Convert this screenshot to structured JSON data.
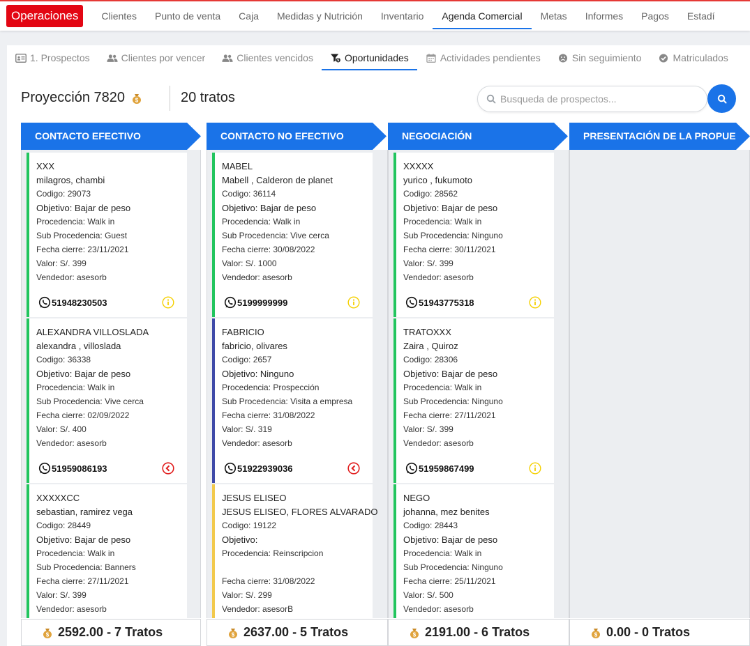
{
  "nav": {
    "brand": "Operaciones",
    "items": [
      "Clientes",
      "Punto de venta",
      "Caja",
      "Medidas y Nutrición",
      "Inventario",
      "Agenda Comercial",
      "Metas",
      "Informes",
      "Pagos",
      "Estadí"
    ],
    "active_index": 5
  },
  "subtabs": {
    "items": [
      "1. Prospectos",
      "Clientes por vencer",
      "Clientes vencidos",
      "Oportunidades",
      "Actividades pendientes",
      "Sin seguimiento",
      "Matriculados"
    ],
    "icons": [
      "id-card-icon",
      "users-icon",
      "users-icon",
      "funnel-icon",
      "calendar-icon",
      "frown-icon",
      "check-circle-icon"
    ],
    "active_index": 3
  },
  "summary": {
    "projection": "Proyección 7820",
    "deals": "20 tratos"
  },
  "search": {
    "placeholder": "Busqueda de prospectos..."
  },
  "colors": {
    "accent": "#1a73e8",
    "brand": "#e30613",
    "green": "#22c55e",
    "navy": "#3f4aa8",
    "yellow": "#f2c94c",
    "red": "#e11d1d"
  },
  "columns": [
    {
      "title": "CONTACTO EFECTIVO",
      "footer": "2592.00 - 7 Tratos",
      "cards": [
        {
          "code_name": "XXX",
          "name": "milagros, chambi",
          "codigo": "Codigo: 29073",
          "objetivo": "Objetivo: Bajar de peso",
          "procedencia": "Procedencia: Walk in",
          "sub_procedencia": "Sub Procedencia: Guest",
          "fecha": "Fecha cierre: 23/11/2021",
          "valor": "Valor: S/. 399",
          "vendedor": "Vendedor: asesorb",
          "phone": "51948230503",
          "status": "info",
          "bar": "green"
        },
        {
          "code_name": "ALEXANDRA VILLOSLADA",
          "name": "alexandra , villoslada",
          "codigo": "Codigo: 36338",
          "objetivo": "Objetivo: Bajar de peso",
          "procedencia": "Procedencia: Walk in",
          "sub_procedencia": "Sub Procedencia: Vive cerca",
          "fecha": "Fecha cierre: 02/09/2022",
          "valor": "Valor: S/. 400",
          "vendedor": "Vendedor: asesorb",
          "phone": "51959086193",
          "status": "back",
          "bar": "green"
        },
        {
          "code_name": "XXXXXCC",
          "name": "sebastian, ramirez vega",
          "codigo": "Codigo: 28449",
          "objetivo": "Objetivo: Bajar de peso",
          "procedencia": "Procedencia: Walk in",
          "sub_procedencia": "Sub Procedencia: Banners",
          "fecha": "Fecha cierre: 27/11/2021",
          "valor": "Valor: S/. 399",
          "vendedor": "Vendedor: asesorb",
          "phone": "",
          "status": "",
          "bar": "green"
        }
      ]
    },
    {
      "title": "CONTACTO NO EFECTIVO",
      "footer": "2637.00 - 5 Tratos",
      "cards": [
        {
          "code_name": "MABEL",
          "name": "Mabell , Calderon de planet",
          "codigo": "Codigo: 36114",
          "objetivo": "Objetivo: Bajar de peso",
          "procedencia": "Procedencia: Walk in",
          "sub_procedencia": "Sub Procedencia: Vive cerca",
          "fecha": "Fecha cierre: 30/08/2022",
          "valor": "Valor: S/. 1000",
          "vendedor": "Vendedor: asesorb",
          "phone": "5199999999",
          "status": "info",
          "bar": "green"
        },
        {
          "code_name": "FABRICIO",
          "name": "fabricio, olivares",
          "codigo": "Codigo: 2657",
          "objetivo": "Objetivo: Ninguno",
          "procedencia": "Procedencia: Prospección",
          "sub_procedencia": "Sub Procedencia: Visita a empresa",
          "fecha": "Fecha cierre: 31/08/2022",
          "valor": "Valor: S/. 319",
          "vendedor": "Vendedor: asesorb",
          "phone": "51922939036",
          "status": "back",
          "bar": "navy"
        },
        {
          "code_name": "JESUS ELISEO",
          "name": "JESUS ELISEO, FLORES ALVARADO",
          "codigo": "Codigo: 19122",
          "objetivo": "Objetivo:",
          "procedencia": "Procedencia: Reinscripcion",
          "sub_procedencia": "",
          "fecha": "Fecha cierre: 31/08/2022",
          "valor": "Valor: S/. 299",
          "vendedor": "Vendedor: asesorB",
          "phone": "",
          "status": "",
          "bar": "yellow"
        }
      ]
    },
    {
      "title": "NEGOCIACIÓN",
      "footer": "2191.00 - 6 Tratos",
      "cards": [
        {
          "code_name": "XXXXX",
          "name": "yurico , fukumoto",
          "codigo": "Codigo: 28562",
          "objetivo": "Objetivo: Bajar de peso",
          "procedencia": "Procedencia: Walk in",
          "sub_procedencia": "Sub Procedencia: Ninguno",
          "fecha": "Fecha cierre: 30/11/2021",
          "valor": "Valor: S/. 399",
          "vendedor": "Vendedor: asesorb",
          "phone": "51943775318",
          "status": "info",
          "bar": "green"
        },
        {
          "code_name": "TRATOXXX",
          "name": "Zaira , Quiroz",
          "codigo": "Codigo: 28306",
          "objetivo": "Objetivo: Bajar de peso",
          "procedencia": "Procedencia: Walk in",
          "sub_procedencia": "Sub Procedencia: Ninguno",
          "fecha": "Fecha cierre: 27/11/2021",
          "valor": "Valor: S/. 399",
          "vendedor": "Vendedor: asesorb",
          "phone": "51959867499",
          "status": "info",
          "bar": "green"
        },
        {
          "code_name": "NEGO",
          "name": "johanna, mez benites",
          "codigo": "Codigo: 28443",
          "objetivo": "Objetivo: Bajar de peso",
          "procedencia": "Procedencia: Walk in",
          "sub_procedencia": "Sub Procedencia: Ninguno",
          "fecha": "Fecha cierre: 25/11/2021",
          "valor": "Valor: S/. 500",
          "vendedor": "Vendedor: asesorb",
          "phone": "",
          "status": "",
          "bar": "green"
        }
      ]
    },
    {
      "title": "PRESENTACIÓN DE LA PROPUEST",
      "footer": "0.00 - 0 Tratos",
      "cards": []
    }
  ]
}
